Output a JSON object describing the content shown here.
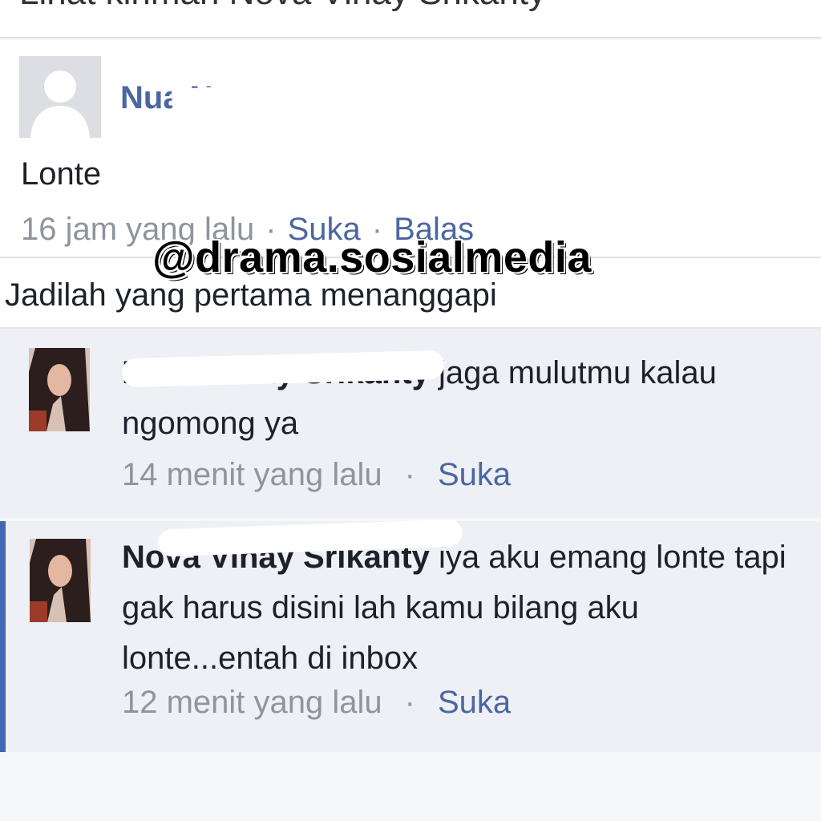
{
  "header": {
    "text": "Lihat kiriman Nova Vinay Srikanty"
  },
  "comment": {
    "author": "Nua Nan",
    "text": "Lonte",
    "time": "16 jam yang lalu",
    "separator": "·",
    "like_label": "Suka",
    "reply_label": "Balas"
  },
  "watermark": "@drama.sosialmedia",
  "first_reply_prompt": "Jadilah yang pertama menanggapi",
  "replies": [
    {
      "author": "Nova Vinay Srikanty",
      "text": " jaga mulutmu kalau ngomong ya",
      "time": "14 menit yang lalu",
      "separator": "·",
      "like_label": "Suka"
    },
    {
      "author": "Nova Vinay Srikanty",
      "text": " iya aku emang lonte tapi gak  harus disini lah kamu bilang aku lonte...entah di inbox",
      "time": "12 menit yang lalu",
      "separator": "·",
      "like_label": "Suka"
    }
  ],
  "colors": {
    "link": "#4b67a1",
    "meta": "#90949c",
    "reply_background": "#eef0f6",
    "highlight_bar": "#4267b2"
  },
  "icons": [
    "default-avatar-icon",
    "profile-photo"
  ]
}
